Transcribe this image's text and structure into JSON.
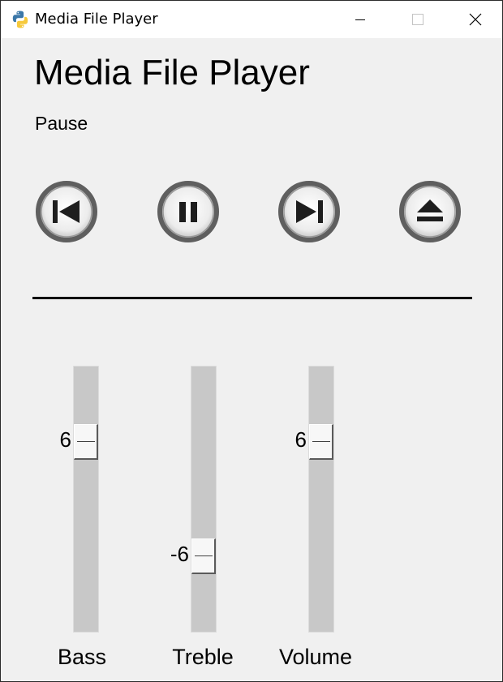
{
  "window": {
    "title": "Media File Player",
    "icon": "python-icon",
    "controls": [
      "minimize-icon",
      "maximize-icon",
      "close-icon"
    ]
  },
  "app": {
    "title": "Media File Player",
    "status": "Pause"
  },
  "transport": {
    "buttons": [
      {
        "name": "previous",
        "icon": "skip-previous-icon"
      },
      {
        "name": "pause",
        "icon": "pause-icon"
      },
      {
        "name": "next",
        "icon": "skip-next-icon"
      },
      {
        "name": "eject",
        "icon": "eject-icon"
      }
    ]
  },
  "sliders": {
    "range": [
      -12,
      12
    ],
    "bass": {
      "label": "Bass",
      "value": 6,
      "value_text": "6"
    },
    "treble": {
      "label": "Treble",
      "value": -6,
      "value_text": "-6"
    },
    "volume": {
      "label": "Volume",
      "value": 6,
      "value_text": "6"
    }
  },
  "colors": {
    "background": "#f0f0f0",
    "trough": "#c8c8c8",
    "button_ring": "#5f5f5f"
  }
}
